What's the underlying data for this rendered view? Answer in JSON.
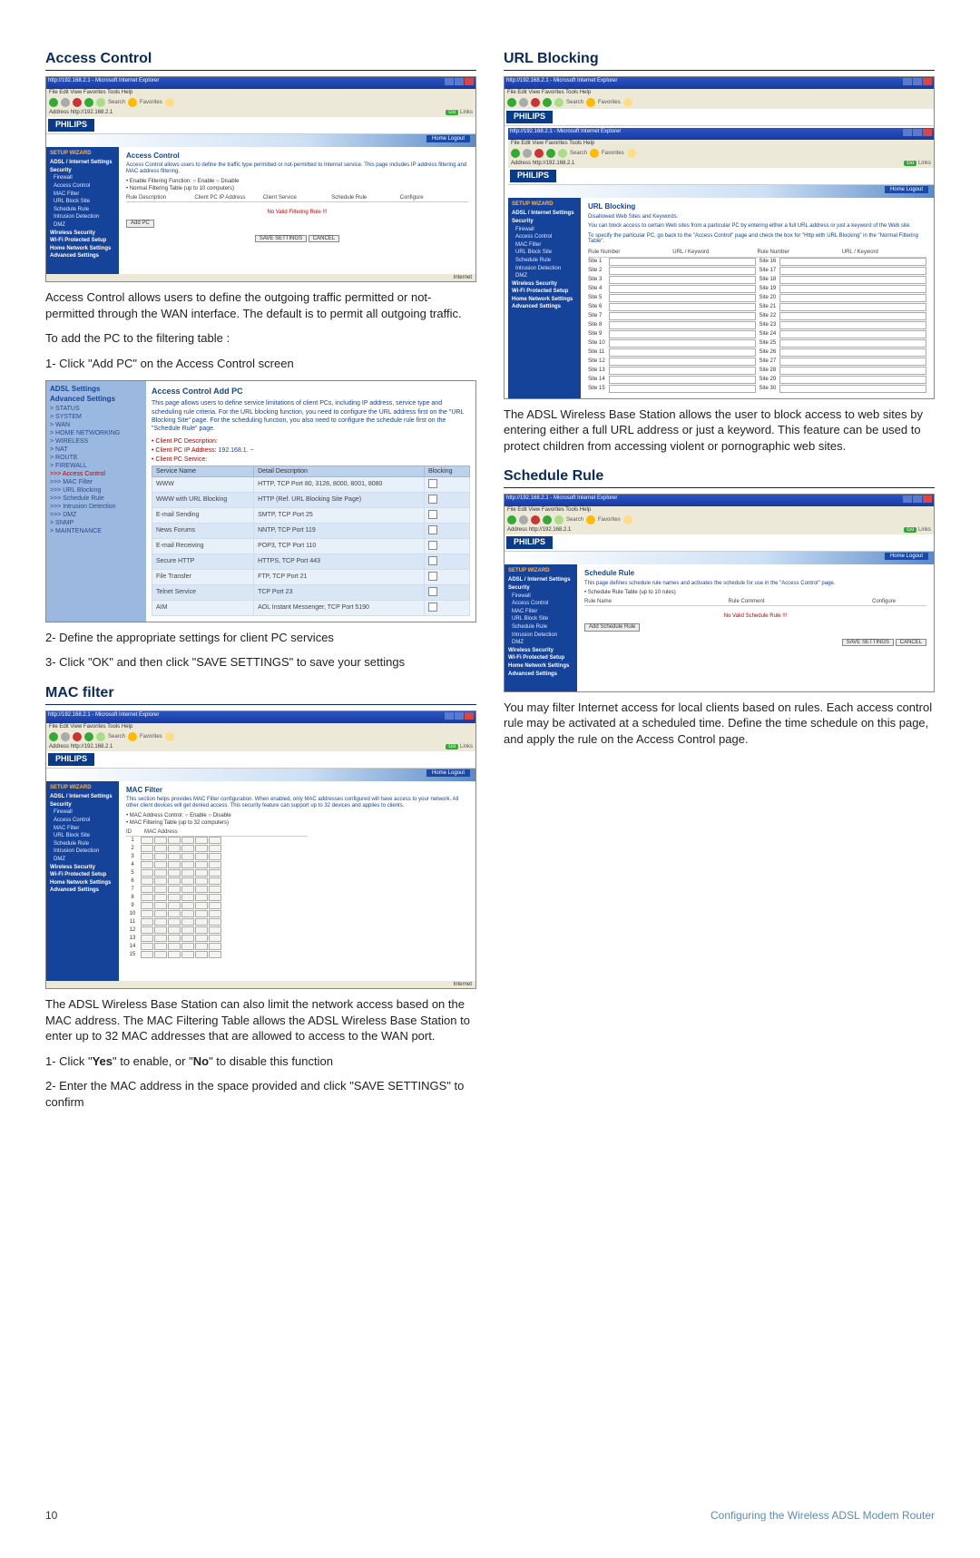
{
  "brand": "PHILIPS",
  "ie": {
    "title": "http://192.168.2.1 - Microsoft Internet Explorer",
    "menu": "File  Edit  View  Favorites  Tools  Help",
    "toolbar": {
      "search": "Search",
      "favorites": "Favorites"
    },
    "addr_label": "Address",
    "addr_url": "http://192.168.2.1",
    "go": "Go",
    "links": "Links",
    "status": "Internet"
  },
  "band_tab": "Home  Logout",
  "left": {
    "access_control": {
      "heading": "Access Control",
      "sidebar": {
        "top": "SETUP WIZARD",
        "b1": "ADSL / Internet Settings",
        "b2": "Security",
        "items": [
          "Firewall",
          "Access Control",
          "MAC Filter",
          "URL Block Site",
          "Schedule Rule",
          "Intrusion Detection",
          "DMZ"
        ],
        "b3": "Wireless Security",
        "b4": "Wi-Fi Protected Setup",
        "b5": "Home Network Settings",
        "b6": "Advanced Settings"
      },
      "panel": {
        "title": "Access Control",
        "desc": "Access Control allows users to define the traffic type permitted or not-permitted to Internet service. This page includes IP address filtering and MAC address filtering.",
        "bullet1": "• Enable Filtering Function:   ○ Enable   ○ Disable",
        "bullet2": "• Normal Filtering Table (up to 10 computers)",
        "cols": [
          "Rule Description",
          "Client PC IP Address",
          "Client Service",
          "Schedule Rule",
          "Configure"
        ],
        "redtext": "No Valid Filtering Rule !!!",
        "addpc": "Add PC",
        "save": "SAVE SETTINGS",
        "cancel": "CANCEL"
      },
      "body1": "Access Control allows users to define the outgoing traffic permitted or not-permitted through the WAN interface. The default is to permit all outgoing traffic.",
      "body2": "To add the PC to the filtering table :",
      "step1": "1-  Click \"Add PC\" on the Access Control screen"
    },
    "addpc_shot": {
      "sidebar": {
        "t1": "ADSL Settings",
        "t2": "Advanced Settings",
        "items": [
          "> STATUS",
          "> SYSTEM",
          "> WAN",
          "> HOME NETWORKING",
          "> WIRELESS",
          "> NAT",
          "> ROUTE",
          "> FIREWALL",
          ">>> Access Control",
          ">>> MAC Filter",
          ">>> URL Blocking",
          ">>> Schedule Rule",
          ">>> Intrusion Detection",
          ">>> DMZ",
          "> SNMP",
          "> MAINTENANCE"
        ]
      },
      "title": "Access Control Add PC",
      "desc": "This page allows users to define service limitations of client PCs, including IP address, service type and scheduling rule criteria. For the URL blocking function, you need to configure the URL address first on the \"URL Blocking Site\" page. For the scheduling function, you also need to configure the schedule rule first on the \"Schedule Rule\" page.",
      "f1_label": "• Client PC Description:",
      "f2_label": "• Client PC IP Address:",
      "f2_val": "192.168.1.",
      "f3_label": "• Client PC Service:",
      "svc_cols": [
        "Service Name",
        "Detail Description",
        "Blocking"
      ],
      "services": [
        {
          "n": "WWW",
          "d": "HTTP, TCP Port 80, 3128, 8000, 8001, 8080"
        },
        {
          "n": "WWW with URL Blocking",
          "d": "HTTP (Ref. URL Blocking Site Page)"
        },
        {
          "n": "E-mail Sending",
          "d": "SMTP, TCP Port 25"
        },
        {
          "n": "News Forums",
          "d": "NNTP, TCP Port 119"
        },
        {
          "n": "E-mail Receiving",
          "d": "POP3, TCP Port 110"
        },
        {
          "n": "Secure HTTP",
          "d": "HTTPS, TCP Port 443"
        },
        {
          "n": "File Transfer",
          "d": "FTP, TCP Port 21"
        },
        {
          "n": "Telnet Service",
          "d": "TCP Port 23"
        },
        {
          "n": "AIM",
          "d": "AOL Instant Messenger, TCP Port 5190"
        }
      ],
      "step2": "2-  Define the appropriate settings for client PC services",
      "step3": "3-  Click \"OK\" and then click \"SAVE SETTINGS\" to save your settings"
    },
    "mac": {
      "heading": "MAC filter",
      "panel": {
        "title": "MAC Filter",
        "desc": "This section helps provides MAC Filter configuration. When enabled, only MAC addresses configured will have access to your network. All other client devices will get denied access. This security feature can support up to 32 devices and applies to clients.",
        "bullet1": "• MAC Address Control:   ○ Enable   ○ Disable",
        "bullet2": "• MAC Filtering Table (up to 32 computers)",
        "col_id": "ID",
        "col_mac": "MAC Address"
      },
      "rows": [
        "1",
        "2",
        "3",
        "4",
        "5",
        "6",
        "7",
        "8",
        "9",
        "10",
        "11",
        "12",
        "13",
        "14",
        "15"
      ],
      "body1": "The ADSL Wireless Base Station can also limit the network access based on the MAC address. The MAC Filtering Table allows the ADSL Wireless Base Station to enter up to 32 MAC addresses that are allowed to access to the WAN port.",
      "s1a": "1-  Click \"",
      "s1b": "Yes",
      "s1c": "\" to enable, or \"",
      "s1d": "No",
      "s1e": "\" to disable this function",
      "s2": "2-  Enter the MAC address in the space provided and click \"SAVE SETTINGS\" to confirm"
    }
  },
  "right": {
    "url": {
      "heading": "URL Blocking",
      "panel": {
        "title": "URL Blocking",
        "sub": "Disallowed Web Sites and Keywords.",
        "desc": "You can block access to certain Web sites from a particular PC by entering either a full URL address or just a keyword of the Web site.",
        "desc2": "To specify the particular PC, go back to the \"Access Control\" page and check the box for \"Http with URL Blocking\" in the \"Normal Filtering Table\".",
        "cols": [
          "Rule Number",
          "URL / Keyword",
          "Rule Number",
          "URL / Keyword"
        ],
        "prefix": "Site "
      },
      "sites_left": [
        "1",
        "2",
        "3",
        "4",
        "5",
        "6",
        "7",
        "8",
        "9",
        "10",
        "11",
        "12",
        "13",
        "14",
        "15"
      ],
      "sites_right": [
        "16",
        "17",
        "18",
        "19",
        "20",
        "21",
        "22",
        "23",
        "24",
        "25",
        "26",
        "27",
        "28",
        "29",
        "30"
      ],
      "body": "The ADSL Wireless Base Station allows the user to block access to web sites by entering either a full URL address or just a keyword. This feature can be used to protect children from accessing violent or pornographic web sites."
    },
    "schedule": {
      "heading": "Schedule Rule",
      "panel": {
        "title": "Schedule Rule",
        "desc": "This page defines schedule rule names and activates the schedule for use in the \"Access Control\" page.",
        "bullet": "• Schedule Rule Table (up to 10 rules)",
        "cols": [
          "Rule Name",
          "Rule Comment",
          "Configure"
        ],
        "redtext": "No Valid Schedule Rule !!!",
        "add": "Add Schedule Rule",
        "save": "SAVE SETTINGS",
        "cancel": "CANCEL"
      },
      "body": "You may filter Internet access for local clients based on rules. Each access control rule may be activated at a scheduled time. Define the time schedule on this page, and apply the rule on the Access Control page."
    }
  },
  "footer": {
    "page": "10",
    "title": "Configuring the Wireless ADSL Modem Router"
  }
}
